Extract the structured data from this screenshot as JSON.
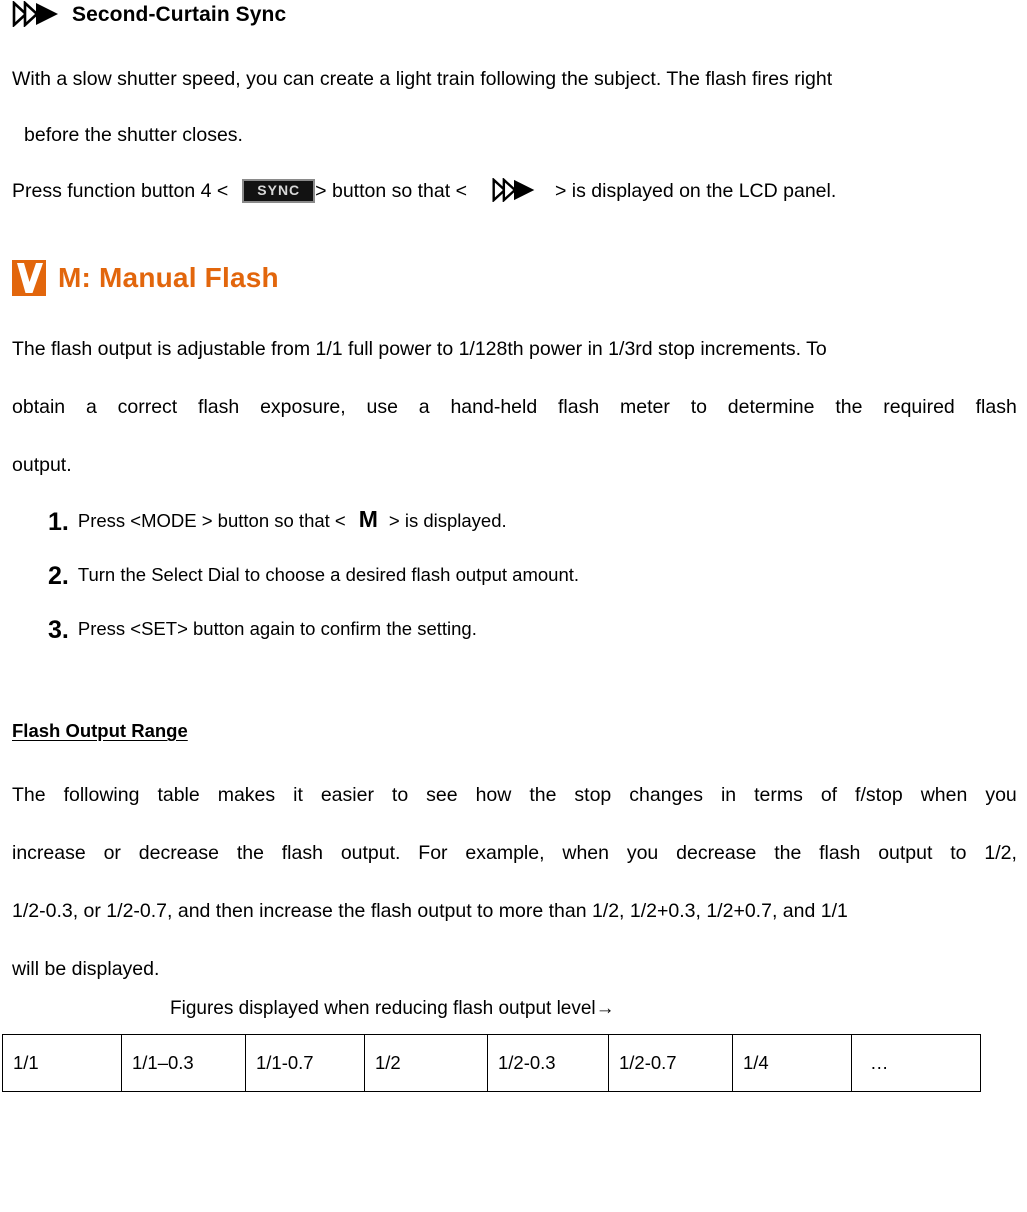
{
  "section_sync": {
    "icon": "second-curtain-sync-icon",
    "title": "Second-Curtain Sync",
    "paragraph_lines": [
      "With a slow shutter speed, you can create a light train following the subject. The flash fires right",
      "before the shutter closes."
    ],
    "instruction": {
      "before_badge": "Press function button 4  <",
      "badge_label": "SYNC",
      "between": "> button so that  <",
      "after_icon": ">  is displayed on the LCD panel.",
      "icon": "second-curtain-sync-icon"
    }
  },
  "section_manual": {
    "icon": "orange-check-square-icon",
    "title": "M: Manual Flash",
    "title_color": "#E2660C",
    "paragraph_lines": [
      [
        "The flash output is adjustable from 1/1 full power to 1/128th power in 1/3rd stop increments. To"
      ],
      [
        "obtain",
        "a",
        "correct",
        "flash",
        "exposure,",
        "use",
        "a",
        "hand-held",
        "flash",
        "meter",
        "to",
        "determine",
        "the",
        "required",
        "flash"
      ],
      [
        "output."
      ]
    ],
    "steps": [
      {
        "number": "1.",
        "before_glyph": "Press  <MODE > button so that  <",
        "glyph": "M",
        "after_glyph": ">  is displayed."
      },
      {
        "number": "2.",
        "text": "Turn the Select Dial to choose a desired flash output amount."
      },
      {
        "number": "3.",
        "text": "Press <SET> button again to confirm the setting."
      }
    ]
  },
  "section_range": {
    "subheading": "Flash Output Range",
    "paragraph_lines": [
      [
        "The",
        "following",
        "table",
        "makes",
        "it",
        "easier",
        "to",
        "see",
        "how",
        "the",
        "stop",
        "changes",
        "in",
        "terms",
        "of",
        "f/stop",
        "when",
        "you"
      ],
      [
        "increase",
        "or",
        "decrease",
        "the",
        "flash",
        "output.",
        "For",
        "example,",
        "when",
        "you",
        "decrease",
        "the",
        "flash",
        "output",
        "to",
        "1/2,"
      ],
      [
        "1/2-0.3, or 1/2-0.7, and then increase the flash output to more than 1/2, 1/2+0.3, 1/2+0.7, and 1/1"
      ],
      [
        "will be displayed."
      ]
    ],
    "table_caption": "Figures displayed when reducing flash output level→",
    "table": {
      "rows": [
        [
          "1/1",
          "1/1–0.3",
          "1/1-0.7",
          "1/2",
          "1/2-0.3",
          "1/2-0.7",
          "1/4",
          "…"
        ]
      ]
    }
  }
}
